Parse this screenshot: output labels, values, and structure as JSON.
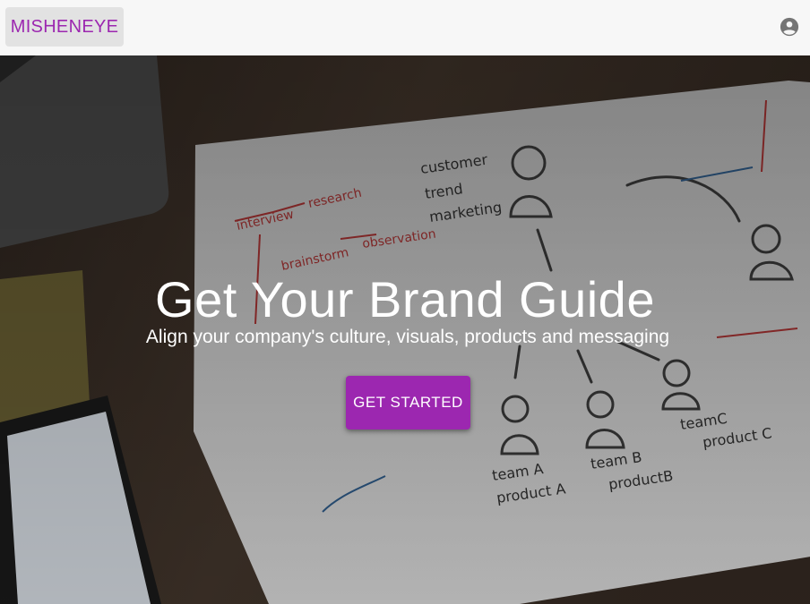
{
  "header": {
    "logo_text": "MISHENEYE",
    "account_icon": "account-circle-icon"
  },
  "hero": {
    "title": "Get Your Brand Guide",
    "subtitle": "Align your company's culture, visuals, products and messaging",
    "cta_label": "GET STARTED",
    "background_image": "desk-with-whiteboard-sketch-and-phone"
  },
  "colors": {
    "accent": "#9c27b0",
    "header_bg": "#f7f7f7",
    "logo_bg": "#e2e2e2"
  }
}
